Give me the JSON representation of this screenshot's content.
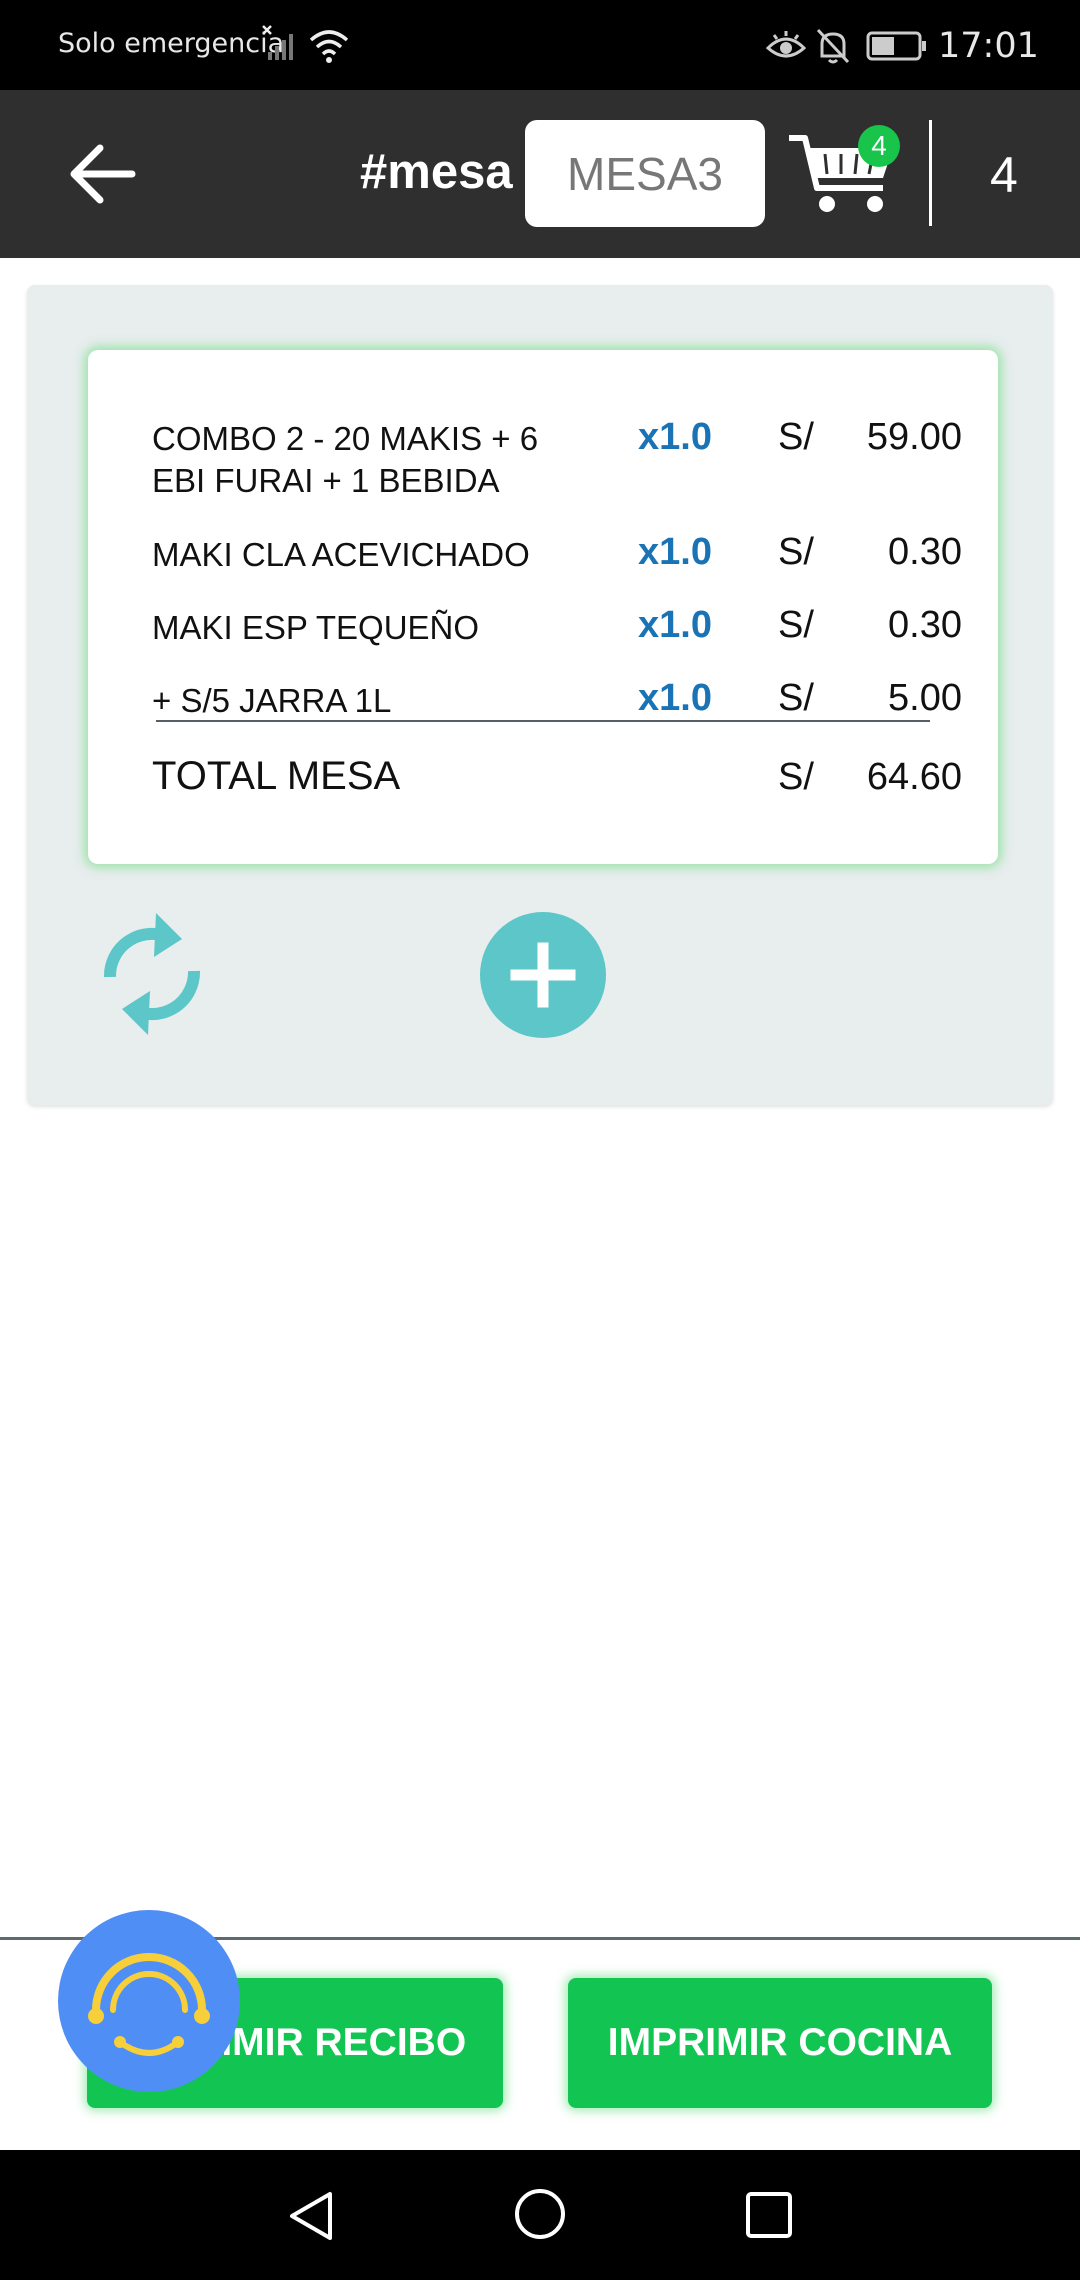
{
  "status_bar": {
    "carrier": "Solo emergencia",
    "time": "17:01",
    "icons": [
      "signal-off-icon",
      "wifi-icon",
      "eye-icon",
      "bell-off-icon",
      "battery-icon"
    ]
  },
  "app_bar": {
    "back_icon": "arrow-left-icon",
    "mesa_label": "#mesa",
    "mesa_value": "MESA3",
    "cart_icon": "cart-icon",
    "cart_badge": "4",
    "count": "4"
  },
  "order": {
    "items": [
      {
        "name_line1": "COMBO 2 - 20 MAKIS + 6",
        "name_line2": "EBI FURAI + 1 BEBIDA",
        "qty": "x1.0",
        "currency": "S/",
        "price": "59.00"
      },
      {
        "name_line1": "MAKI CLA ACEVICHADO",
        "name_line2": "",
        "qty": "x1.0",
        "currency": "S/",
        "price": "0.30"
      },
      {
        "name_line1": "MAKI ESP TEQUEÑO",
        "name_line2": "",
        "qty": "x1.0",
        "currency": "S/",
        "price": "0.30"
      },
      {
        "name_line1": "+ S/5 JARRA 1L",
        "name_line2": "",
        "qty": "x1.0",
        "currency": "S/",
        "price": "5.00"
      }
    ],
    "total_label": "TOTAL MESA",
    "total_currency": "S/",
    "total_value": "64.60"
  },
  "actions": {
    "refresh_icon": "refresh-icon",
    "add_icon": "plus-icon"
  },
  "buttons": {
    "print_receipt": "IMPRIMIR RECIBO",
    "print_kitchen": "IMPRIMIR COCINA"
  },
  "colors": {
    "app_bar": "#2f2f2f",
    "accent_green": "#12c553",
    "qty_blue": "#1a73b5",
    "teal": "#5cc6c8",
    "assist_blue": "#4f8ff5",
    "assist_yellow": "#f6cf3a"
  }
}
